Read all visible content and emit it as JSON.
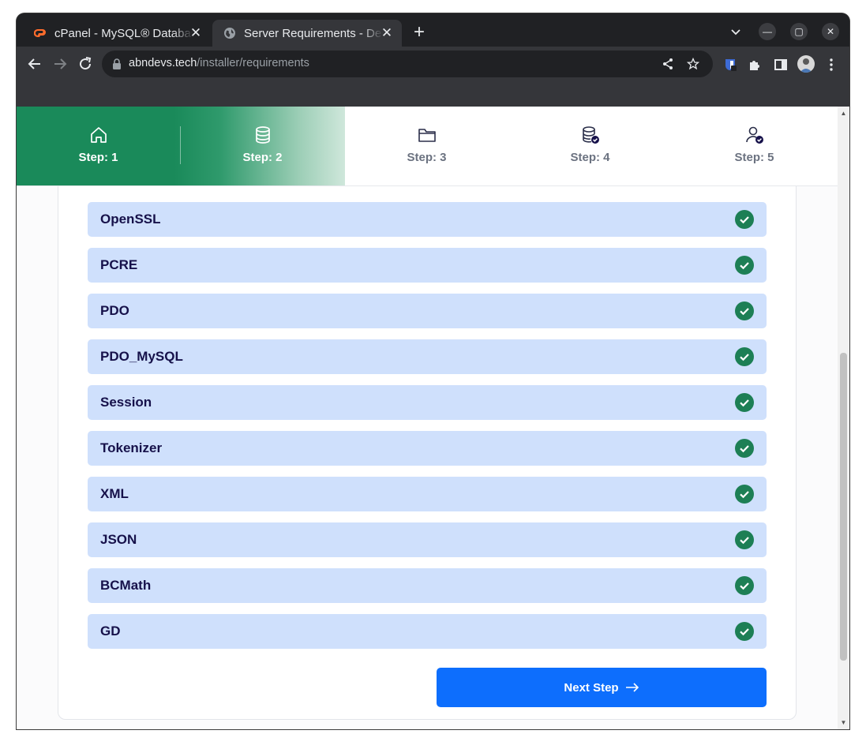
{
  "browser": {
    "tabs": [
      {
        "title": "cPanel - MySQL® Databases",
        "active": false,
        "icon": "cpanel-logo"
      },
      {
        "title": "Server Requirements - Demo",
        "active": true,
        "icon": "globe-icon"
      }
    ],
    "url_host": "abndevs.tech",
    "url_path": "/installer/requirements"
  },
  "steps": [
    {
      "label": "Step: 1",
      "icon": "home-icon",
      "state": "done"
    },
    {
      "label": "Step: 2",
      "icon": "database-icon",
      "state": "current"
    },
    {
      "label": "Step: 3",
      "icon": "folder-icon",
      "state": "pending"
    },
    {
      "label": "Step: 4",
      "icon": "database-check-icon",
      "state": "pending"
    },
    {
      "label": "Step: 5",
      "icon": "user-check-icon",
      "state": "pending"
    }
  ],
  "requirements": [
    {
      "name": "OpenSSL",
      "status": "ok"
    },
    {
      "name": "PCRE",
      "status": "ok"
    },
    {
      "name": "PDO",
      "status": "ok"
    },
    {
      "name": "PDO_MySQL",
      "status": "ok"
    },
    {
      "name": "Session",
      "status": "ok"
    },
    {
      "name": "Tokenizer",
      "status": "ok"
    },
    {
      "name": "XML",
      "status": "ok"
    },
    {
      "name": "JSON",
      "status": "ok"
    },
    {
      "name": "BCMath",
      "status": "ok"
    },
    {
      "name": "GD",
      "status": "ok"
    }
  ],
  "next_button": {
    "label": "Next Step"
  },
  "colors": {
    "step_fill": "#1a8a5a",
    "requirement_bg": "#cfe0fc",
    "check_green": "#1d7f55",
    "primary": "#0d6efd",
    "requirement_text": "#16114a"
  }
}
